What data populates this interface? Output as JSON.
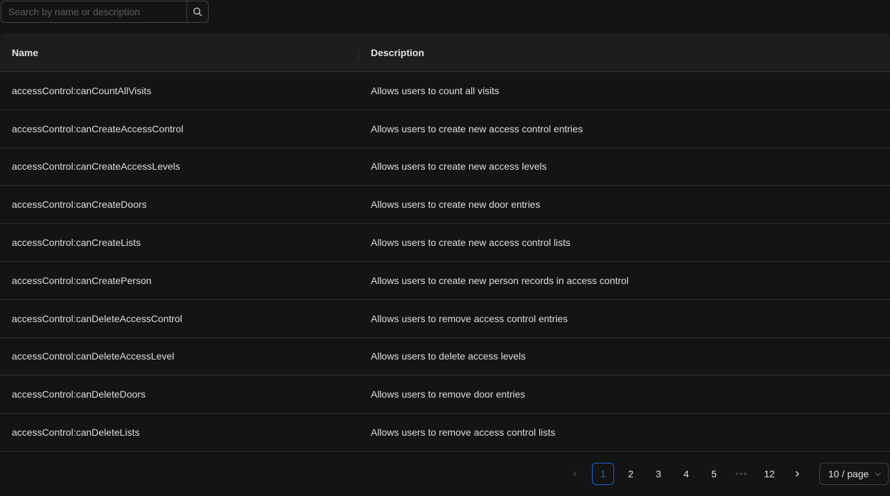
{
  "search": {
    "placeholder": "Search by name or description",
    "value": "",
    "icon": "search-icon"
  },
  "table": {
    "columns": [
      "Name",
      "Description"
    ],
    "rows": [
      {
        "name": "accessControl:canCountAllVisits",
        "description": "Allows users to count all visits"
      },
      {
        "name": "accessControl:canCreateAccessControl",
        "description": "Allows users to create new access control entries"
      },
      {
        "name": "accessControl:canCreateAccessLevels",
        "description": "Allows users to create new access levels"
      },
      {
        "name": "accessControl:canCreateDoors",
        "description": "Allows users to create new door entries"
      },
      {
        "name": "accessControl:canCreateLists",
        "description": "Allows users to create new access control lists"
      },
      {
        "name": "accessControl:canCreatePerson",
        "description": "Allows users to create new person records in access control"
      },
      {
        "name": "accessControl:canDeleteAccessControl",
        "description": "Allows users to remove access control entries"
      },
      {
        "name": "accessControl:canDeleteAccessLevel",
        "description": "Allows users to delete access levels"
      },
      {
        "name": "accessControl:canDeleteDoors",
        "description": "Allows users to remove door entries"
      },
      {
        "name": "accessControl:canDeleteLists",
        "description": "Allows users to remove access control lists"
      }
    ]
  },
  "pagination": {
    "pages": [
      "1",
      "2",
      "3",
      "4",
      "5"
    ],
    "ellipsis": "•••",
    "last_page": "12",
    "current_page": "1",
    "page_size_label": "10 / page",
    "prev_icon": "chevron-left-icon",
    "next_icon": "chevron-right-icon"
  },
  "colors": {
    "background": "#141414",
    "header_bg": "#1d1d1d",
    "border": "#303030",
    "accent": "#1668dc"
  }
}
